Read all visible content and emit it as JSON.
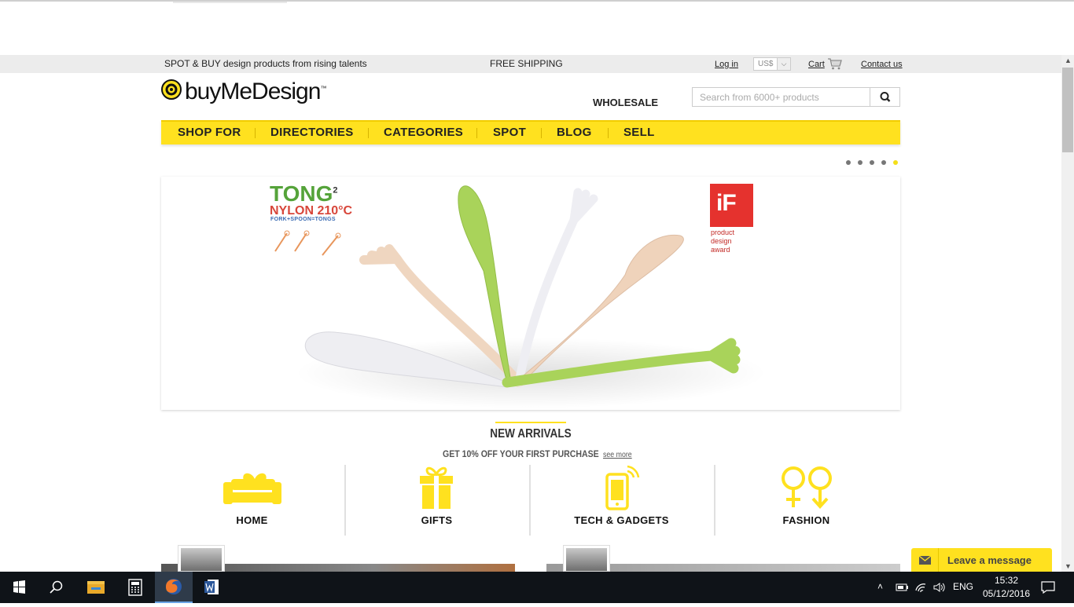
{
  "topbar": {
    "tagline": "SPOT & BUY design products from rising talents",
    "shipping": "FREE SHIPPING",
    "login": "Log in",
    "currency": "US$",
    "cart": "Cart",
    "contact": "Contact us"
  },
  "header": {
    "brand": "buyMeDesign",
    "brand_mark": "™",
    "wholesale": "WHOLESALE",
    "search_placeholder": "Search from 6000+ products"
  },
  "nav": {
    "items": [
      "SHOP FOR",
      "DIRECTORIES",
      "CATEGORIES",
      "SPOT",
      "BLOG",
      "SELL"
    ]
  },
  "slider": {
    "dots": 5,
    "active_index": 4
  },
  "banner": {
    "tong_title": "TONG",
    "tong_sup": "2",
    "tong_nylon": "NYLON 210°C",
    "tong_sub": "FORK+SPOON=TONGS",
    "if_logo": "iF",
    "if_caption_1": "product",
    "if_caption_2": "design",
    "if_caption_3": "award"
  },
  "arrivals": {
    "title": "NEW ARRIVALS",
    "promo": "GET 10% OFF YOUR FIRST PURCHASE",
    "see_more": "see more"
  },
  "categories": [
    {
      "label": "HOME",
      "icon": "sofa-heart-icon"
    },
    {
      "label": "GIFTS",
      "icon": "gift-icon"
    },
    {
      "label": "TECH & GADGETS",
      "icon": "phone-icon"
    },
    {
      "label": "FASHION",
      "icon": "gender-icon"
    }
  ],
  "chat": {
    "label": "Leave a message"
  },
  "taskbar": {
    "language": "ENG",
    "time": "15:32",
    "date": "05/12/2016"
  },
  "colors": {
    "accent": "#ffe11f",
    "topbar": "#ececec",
    "taskbar": "#0f1318"
  }
}
